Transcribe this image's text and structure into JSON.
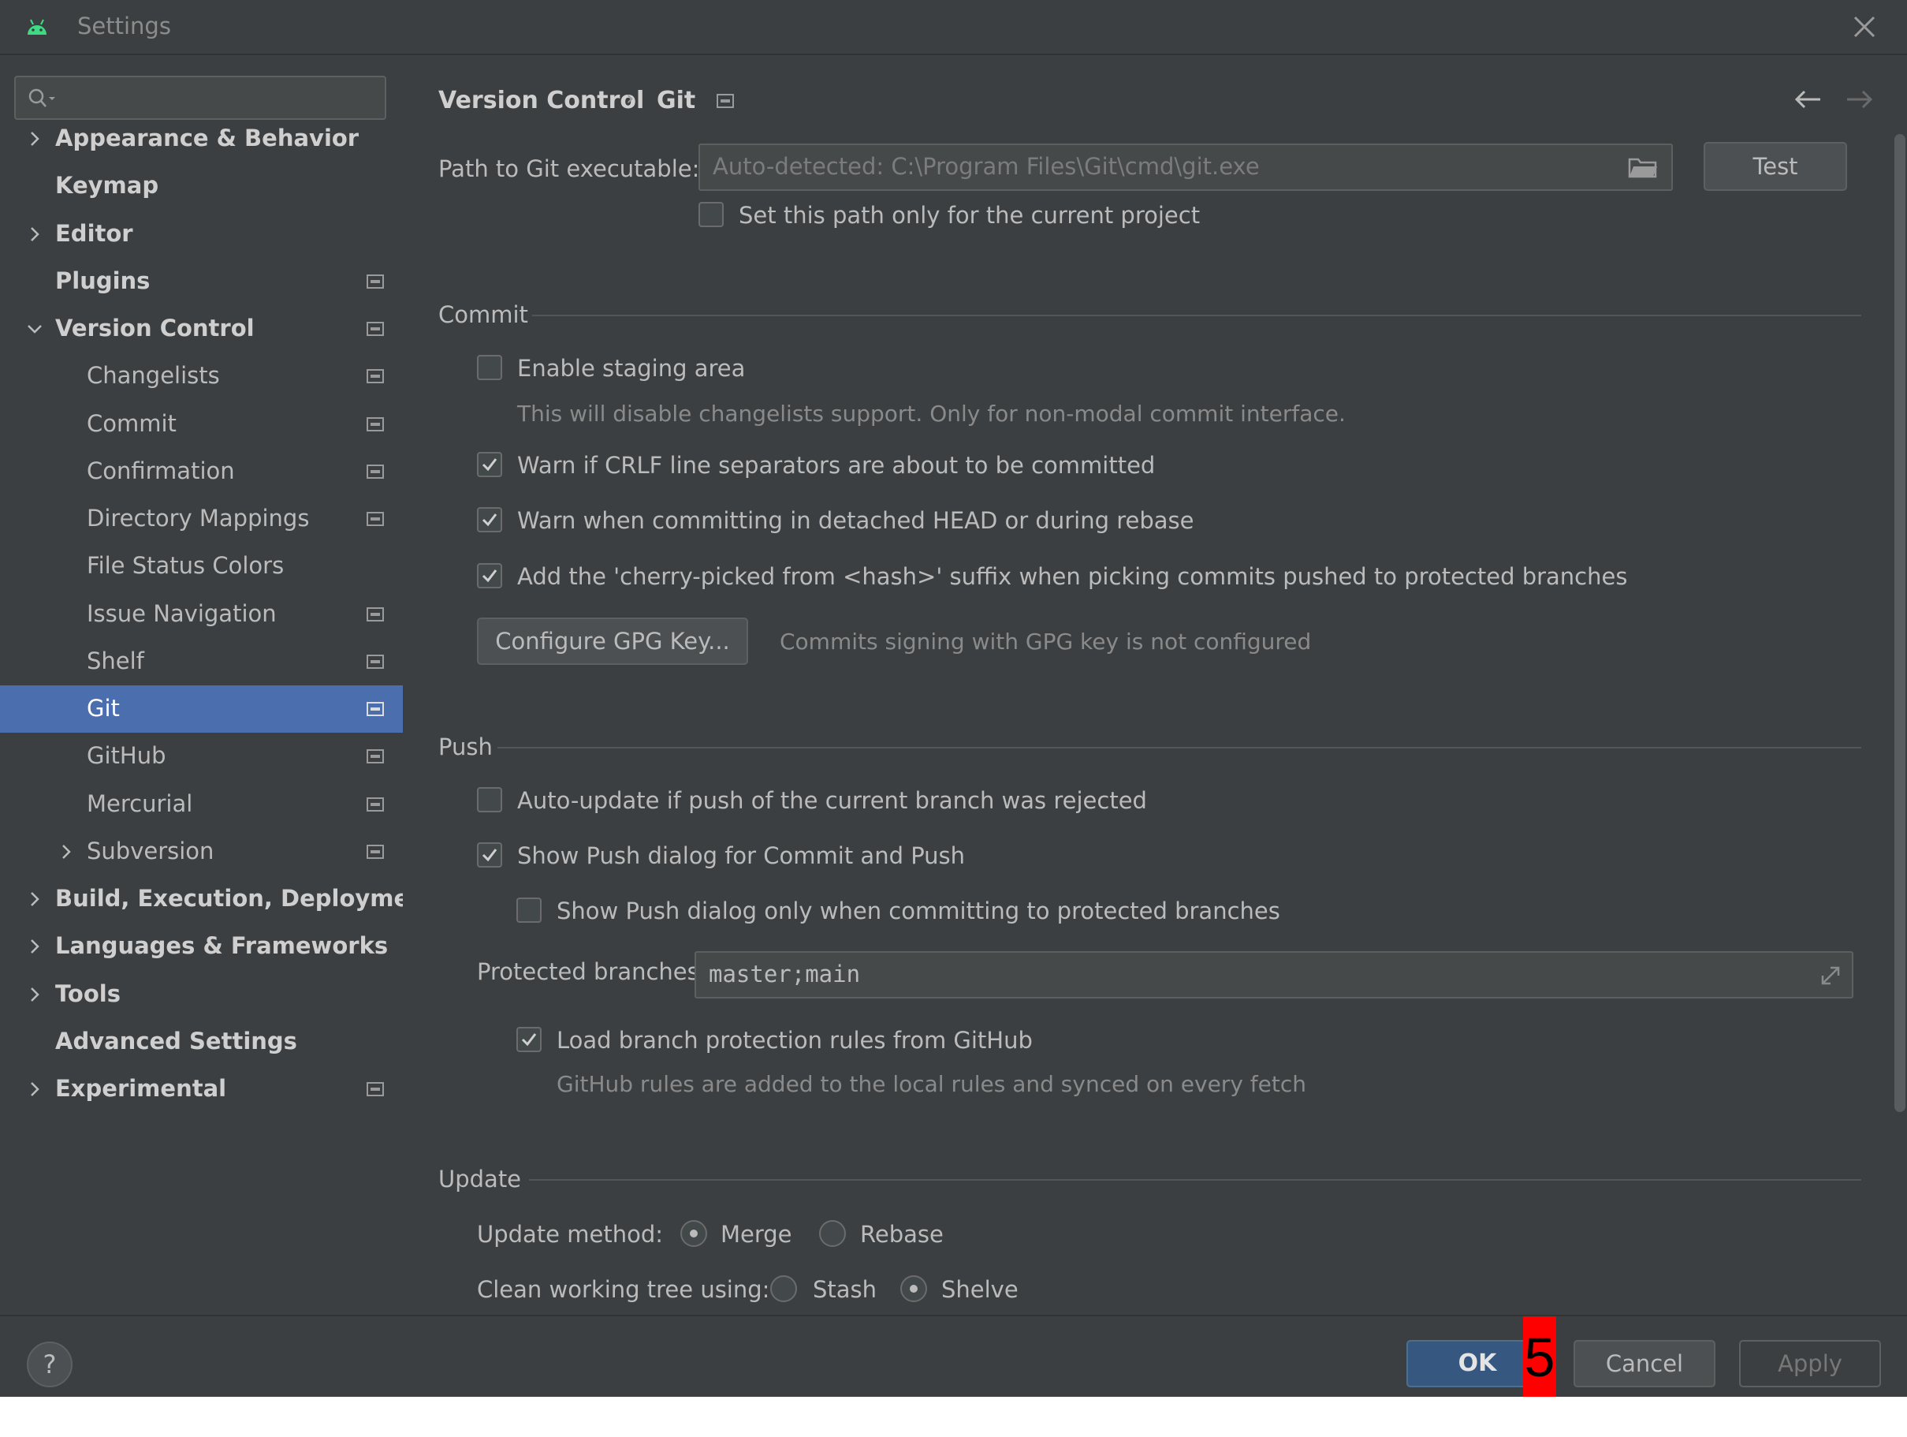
{
  "window": {
    "title": "Settings",
    "colors": {
      "background": "#3c3f41",
      "selection": "#4b6eaf",
      "ok_button": "#365880",
      "marker": "#ff0000"
    }
  },
  "sidebar": {
    "search": {
      "placeholder": "",
      "icon": "search-icon"
    },
    "items": [
      {
        "label": "Appearance & Behavior",
        "bold": true,
        "chevron": "right"
      },
      {
        "label": "Keymap",
        "bold": true
      },
      {
        "label": "Editor",
        "bold": true,
        "chevron": "right"
      },
      {
        "label": "Plugins",
        "bold": true,
        "badge": true
      },
      {
        "label": "Version Control",
        "bold": true,
        "chevron": "down",
        "badge": true
      },
      {
        "label": "Changelists",
        "badge": true
      },
      {
        "label": "Commit",
        "badge": true
      },
      {
        "label": "Confirmation",
        "badge": true
      },
      {
        "label": "Directory Mappings",
        "badge": true
      },
      {
        "label": "File Status Colors"
      },
      {
        "label": "Issue Navigation",
        "badge": true
      },
      {
        "label": "Shelf",
        "badge": true
      },
      {
        "label": "Git",
        "badge": true,
        "selected": true
      },
      {
        "label": "GitHub",
        "badge": true
      },
      {
        "label": "Mercurial",
        "badge": true
      },
      {
        "label": "Subversion",
        "badge": true,
        "chevron": "right"
      },
      {
        "label": "Build, Execution, Deployment",
        "bold": true,
        "chevron": "right"
      },
      {
        "label": "Languages & Frameworks",
        "bold": true,
        "chevron": "right"
      },
      {
        "label": "Tools",
        "bold": true,
        "chevron": "right"
      },
      {
        "label": "Advanced Settings",
        "bold": true
      },
      {
        "label": "Experimental",
        "bold": true,
        "chevron": "right",
        "badge": true
      }
    ]
  },
  "header": {
    "breadcrumb": [
      "Version Control",
      "Git"
    ],
    "separator": "›"
  },
  "git_path": {
    "label": "Path to Git executable:",
    "placeholder": "Auto-detected: C:\\Program Files\\Git\\cmd\\git.exe",
    "value": "",
    "test_label": "Test",
    "current_project_only": {
      "label": "Set this path only for the current project",
      "checked": false
    }
  },
  "commit": {
    "title": "Commit",
    "staging": {
      "label": "Enable staging area",
      "checked": false,
      "hint": "This will disable changelists support. Only for non-modal commit interface."
    },
    "crlf": {
      "label": "Warn if CRLF line separators are about to be committed",
      "checked": true
    },
    "detached": {
      "label": "Warn when committing in detached HEAD or during rebase",
      "checked": true
    },
    "cherry": {
      "label": "Add the 'cherry-picked from <hash>' suffix when picking commits pushed to protected branches",
      "checked": true
    },
    "gpg_button": "Configure GPG Key...",
    "gpg_status": "Commits signing with GPG key is not configured"
  },
  "push": {
    "title": "Push",
    "auto_update": {
      "label": "Auto-update if push of the current branch was rejected",
      "checked": false
    },
    "show_dialog": {
      "label": "Show Push dialog for Commit and Push",
      "checked": true
    },
    "protected_only": {
      "label": "Show Push dialog only when committing to protected branches",
      "checked": false
    },
    "protected_branches": {
      "label": "Protected branches:",
      "value": "master;main"
    },
    "load_rules": {
      "label": "Load branch protection rules from GitHub",
      "checked": true,
      "hint": "GitHub rules are added to the local rules and synced on every fetch"
    }
  },
  "update": {
    "title": "Update",
    "method": {
      "label": "Update method:",
      "options": [
        "Merge",
        "Rebase"
      ],
      "selected": "Merge"
    },
    "clean": {
      "label": "Clean working tree using:",
      "options": [
        "Stash",
        "Shelve"
      ],
      "selected": "Shelve"
    }
  },
  "footer": {
    "help": "?",
    "ok": "OK",
    "cancel": "Cancel",
    "apply": "Apply",
    "marker": "5"
  }
}
